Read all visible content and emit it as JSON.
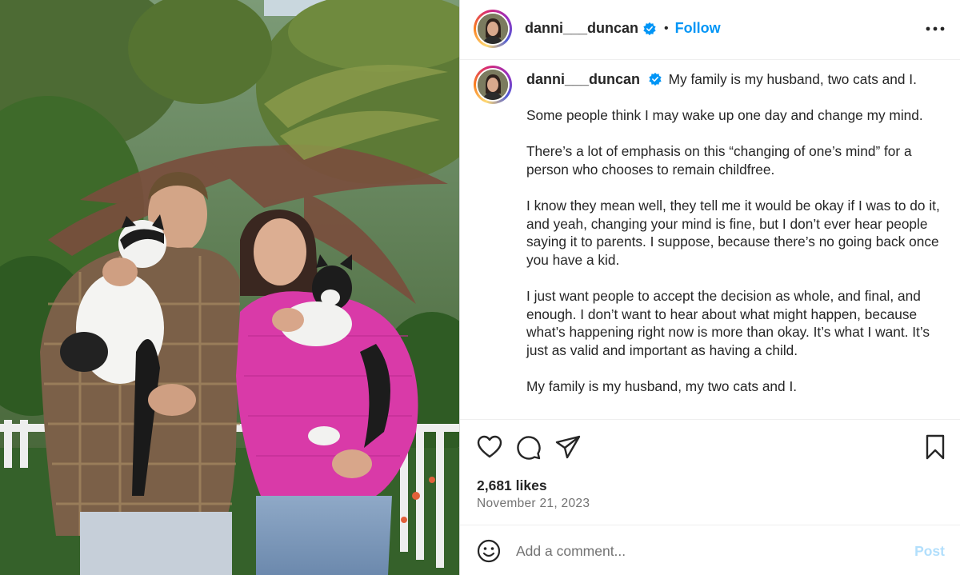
{
  "post": {
    "username": "danni___duncan",
    "verified": true,
    "separator": "•",
    "follow_label": "Follow",
    "more_icon": "more-horizontal-icon",
    "photo_alt": "Couple holding two black-and-white cats in a garden"
  },
  "caption": {
    "username": "danni___duncan",
    "first_line": "My family is my husband, two cats and I.",
    "paragraphs": [
      "Some people think I may wake up one day and change my mind.",
      "There’s a lot of emphasis on this “changing of one’s mind” for a person who chooses to remain childfree.",
      "I know they mean well, they tell me it would be okay if I was to do it, and yeah, changing your mind is fine, but I don’t ever hear people saying it to parents. I suppose, because there’s no going back once you have a kid.",
      "I just want people to accept the decision as whole, and final, and enough. I don’t want to hear about what might happen, because what’s happening right now is more than okay. It’s what I want. It’s just as valid and important as having a child.",
      "My family is my husband, my two cats and I."
    ]
  },
  "actions": {
    "like_icon": "heart-icon",
    "comment_icon": "comment-icon",
    "share_icon": "share-icon",
    "save_icon": "bookmark-icon",
    "likes": "2,681 likes",
    "date": "November 21, 2023"
  },
  "comment": {
    "emoji_icon": "emoji-icon",
    "placeholder": "Add a comment...",
    "post_label": "Post"
  },
  "colors": {
    "accent": "#0095f6",
    "post_disabled": "#b2dffc",
    "magenta_sweater": "#d93aa8",
    "text": "#262626",
    "muted": "#737373"
  }
}
